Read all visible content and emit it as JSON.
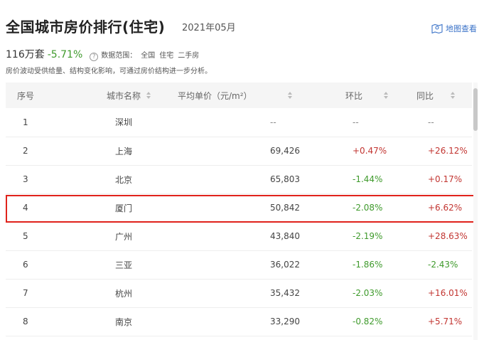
{
  "header": {
    "title": "全国城市房价排行(住宅)",
    "date": "2021年05月",
    "map_link": "地图查看",
    "map_icon": "map-pin-icon"
  },
  "summary": {
    "price": "116万套",
    "change": "-5.71%",
    "scope_label": "数据范围：",
    "scope_items": [
      "全国",
      "住宅",
      "二手房"
    ],
    "note": "房价波动受供给量、结构变化影响，可通过房价结构进一步分析。"
  },
  "table": {
    "columns": [
      "序号",
      "城市名称",
      "平均单价（元/m²）",
      "环比",
      "同比"
    ],
    "rows": [
      {
        "rank": "1",
        "city": "深圳",
        "price": "--",
        "mom": "--",
        "yoy": "--"
      },
      {
        "rank": "2",
        "city": "上海",
        "price": "69,426",
        "mom": "+0.47%",
        "yoy": "+26.12%"
      },
      {
        "rank": "3",
        "city": "北京",
        "price": "65,803",
        "mom": "-1.44%",
        "yoy": "+0.17%"
      },
      {
        "rank": "4",
        "city": "厦门",
        "price": "50,842",
        "mom": "-2.08%",
        "yoy": "+6.62%"
      },
      {
        "rank": "5",
        "city": "广州",
        "price": "43,840",
        "mom": "-2.19%",
        "yoy": "+28.63%"
      },
      {
        "rank": "6",
        "city": "三亚",
        "price": "36,022",
        "mom": "-1.86%",
        "yoy": "-2.43%"
      },
      {
        "rank": "7",
        "city": "杭州",
        "price": "35,432",
        "mom": "-2.03%",
        "yoy": "+16.01%"
      },
      {
        "rank": "8",
        "city": "南京",
        "price": "33,290",
        "mom": "-0.82%",
        "yoy": "+5.71%"
      }
    ],
    "highlighted_rank": "4"
  },
  "colors": {
    "positive": "#c23531",
    "negative": "#3f9a2c",
    "highlight_border": "#e0221b",
    "link": "#3b73c8"
  }
}
